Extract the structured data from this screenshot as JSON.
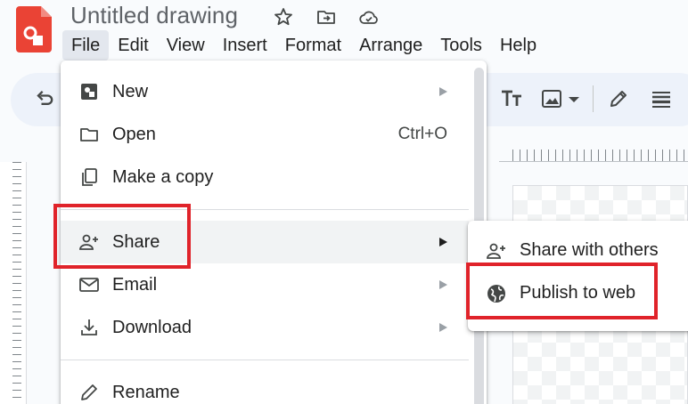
{
  "app": {
    "doc_title": "Untitled drawing",
    "brand_color": "#ea4335"
  },
  "menubar": {
    "items": [
      "File",
      "Edit",
      "View",
      "Insert",
      "Format",
      "Arrange",
      "Tools",
      "Help"
    ],
    "active": "File"
  },
  "title_icons": [
    "star-icon",
    "move-to-folder-icon",
    "cloud-saved-icon"
  ],
  "toolbar": {
    "icons": [
      "undo-icon",
      "text-style-icon",
      "image-icon",
      "chevron-down-icon",
      "pen-icon",
      "line-weight-icon"
    ]
  },
  "file_menu": {
    "items": [
      {
        "label": "New",
        "icon": "new-drawing-icon",
        "submenu": true
      },
      {
        "label": "Open",
        "icon": "folder-icon",
        "shortcut": "Ctrl+O"
      },
      {
        "label": "Make a copy",
        "icon": "copy-icon"
      },
      {
        "label": "Share",
        "icon": "person-add-icon",
        "submenu": true,
        "highlighted": true
      },
      {
        "label": "Email",
        "icon": "mail-icon",
        "submenu": true
      },
      {
        "label": "Download",
        "icon": "download-icon",
        "submenu": true
      },
      {
        "label": "Rename",
        "icon": "pencil-icon"
      }
    ]
  },
  "share_submenu": {
    "items": [
      {
        "label": "Share with others",
        "icon": "person-add-icon"
      },
      {
        "label": "Publish to web",
        "icon": "globe-icon"
      }
    ]
  },
  "annotation_color": "#e0232a"
}
